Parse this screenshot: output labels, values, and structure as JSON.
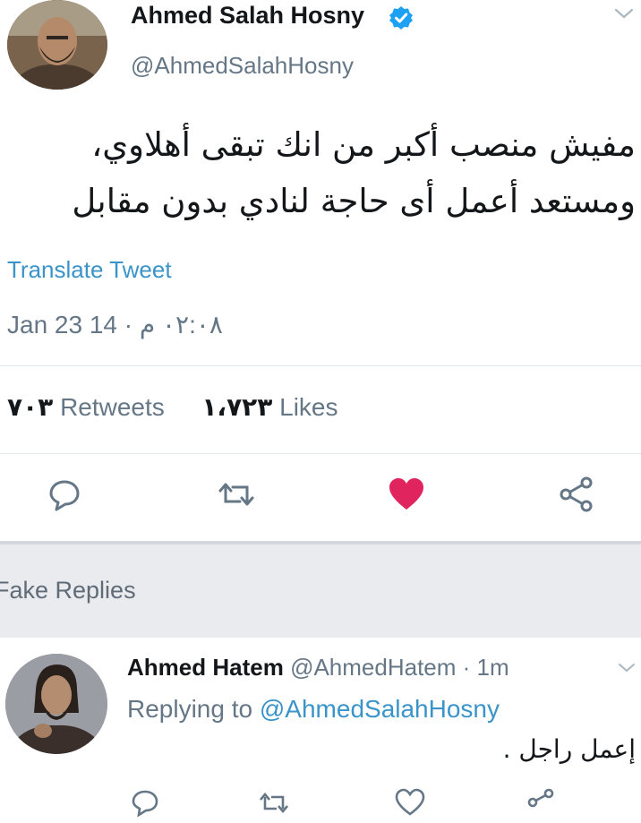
{
  "tweet": {
    "author_name": "Ahmed Salah Hosny",
    "author_handle": "@AhmedSalahHosny",
    "text_lines": [
      "مفيش منصب أكبر من انك تبقى أهلاوي،",
      "ومستعد أعمل أى حاجة لنادي بدون مقابل"
    ],
    "translate_label": "Translate Tweet",
    "timestamp": "Jan 23 14 · ٠٢:٠٨ م",
    "retweets_count": "٧٠٣",
    "retweets_label": "Retweets",
    "likes_count": "١،٧٢٣",
    "likes_label": "Likes",
    "liked": true,
    "actions": [
      "reply-icon",
      "retweet-icon",
      "like-icon",
      "share-icon"
    ],
    "colors": {
      "like": "#e0245e",
      "link": "#3b94c9",
      "verified": "#1da1f2"
    }
  },
  "replies_section": {
    "title": "Fake Replies",
    "replies": [
      {
        "name": "Ahmed Hatem",
        "handle": "@AhmedHatem",
        "time": "· 1m",
        "replying_prefix": "Replying to",
        "replying_to": "@AhmedSalahHosny",
        "text": "إعمل راجل ."
      }
    ]
  }
}
